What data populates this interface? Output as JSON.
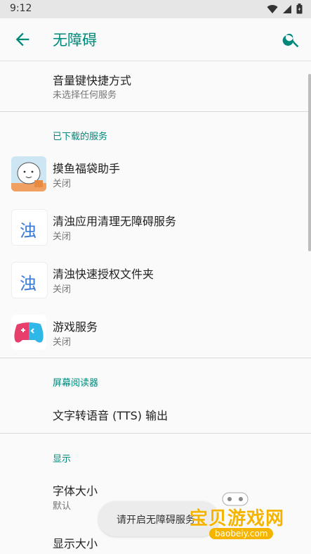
{
  "status": {
    "time": "9:12"
  },
  "appbar": {
    "title": "无障碍"
  },
  "volume": {
    "title": "音量键快捷方式",
    "subtitle": "未选择任何服务"
  },
  "section_downloaded": "已下载的服务",
  "services": [
    {
      "title": "摸鱼福袋助手",
      "subtitle": "关闭"
    },
    {
      "title": "清浊应用清理无障碍服务",
      "subtitle": "关闭",
      "icon_text": "浊"
    },
    {
      "title": "清浊快速授权文件夹",
      "subtitle": "关闭",
      "icon_text": "浊"
    },
    {
      "title": "游戏服务",
      "subtitle": "关闭"
    }
  ],
  "section_screenreader": "屏幕阅读器",
  "tts": {
    "title": "文字转语音 (TTS) 输出"
  },
  "section_display": "显示",
  "fontsize": {
    "title": "字体大小",
    "subtitle": "默认"
  },
  "displaysize": {
    "title": "显示大小"
  },
  "toast": "请开启无障碍服务",
  "watermark": {
    "brand": "宝贝游戏网",
    "domain": "baobeiy.com"
  },
  "colors": {
    "accent": "#00897b",
    "gameIcon": "#e83e6e"
  }
}
